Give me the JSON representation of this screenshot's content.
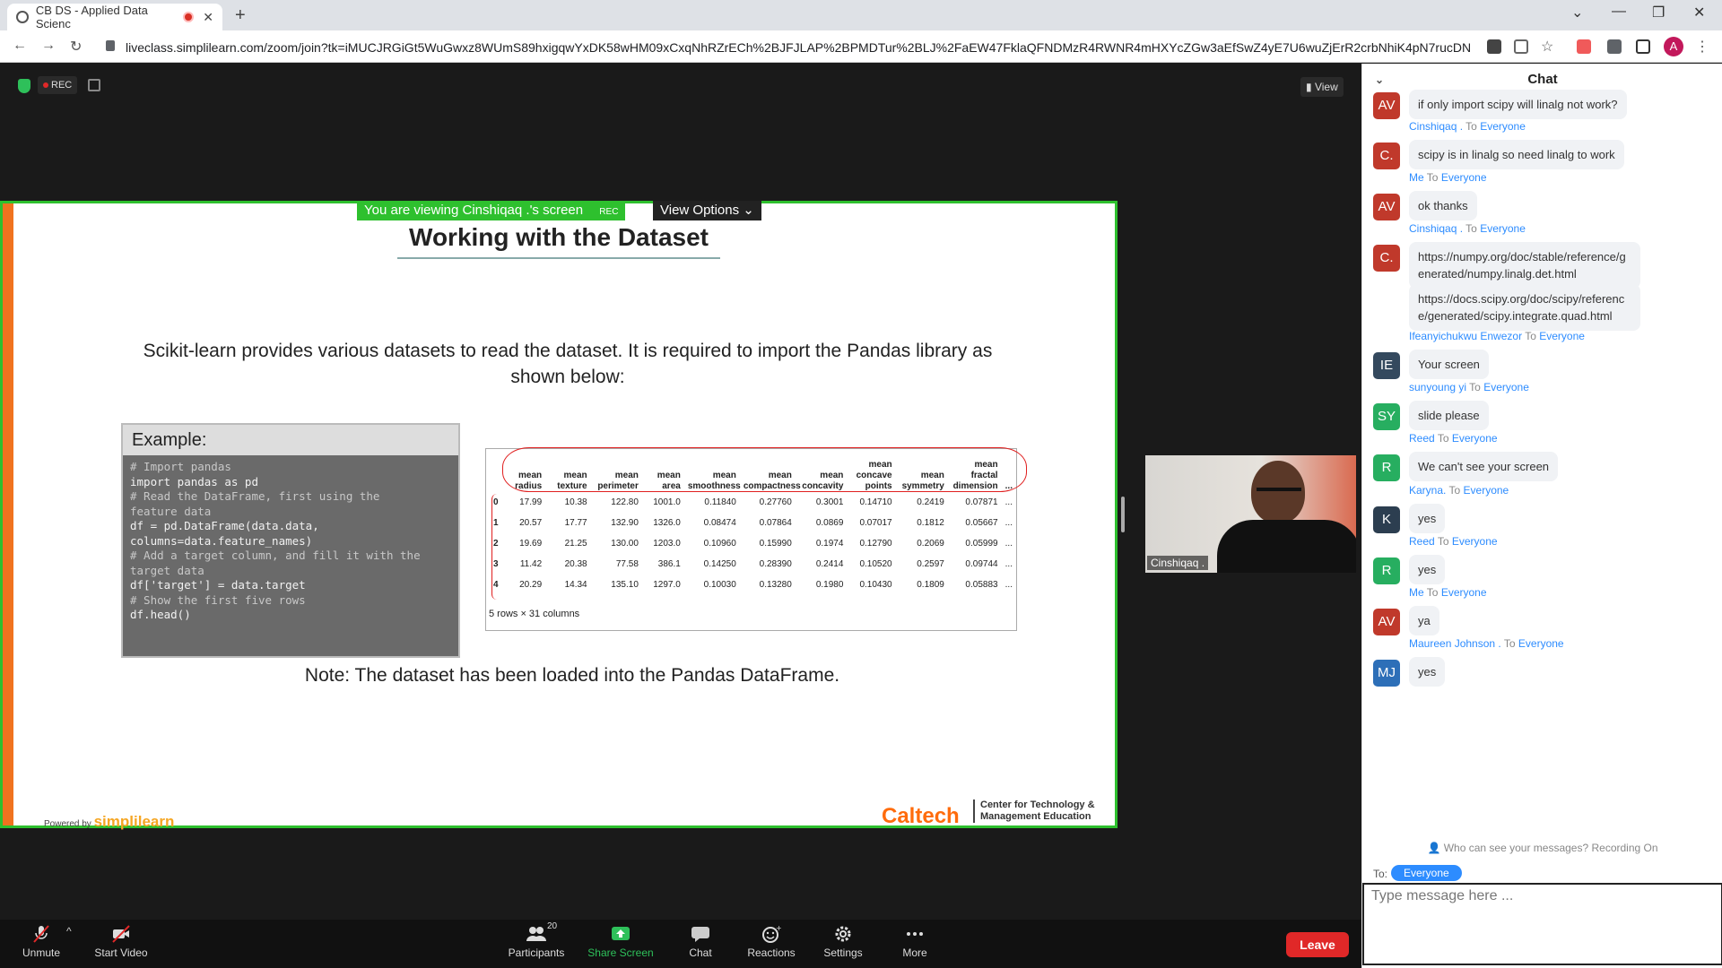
{
  "browser": {
    "tab_title": "CB DS - Applied Data Scienc",
    "url": "liveclass.simplilearn.com/zoom/join?tk=iMUCJRGiGt5WuGwxz8WUmS89hxigqwYxDK58wHM09xCxqNhRZrECh%2BJFJLAP%2BPMDTur%2BLJ%2FaEW47FklaQFNDMzR4RWNR4mHXYcZGw3aEfSwZ4yE7U6wuZjErR2crbNhiK4pN7rucDNn5pcxSOy6...",
    "profile_initial": "A"
  },
  "zoom": {
    "rec_label": "REC",
    "view_label": "View",
    "viewing_banner": "You are viewing Cinshiqaq .'s screen",
    "banner_rec": "REC",
    "view_options": "View Options",
    "presenter_name": "Cinshiqaq ."
  },
  "slide": {
    "title": "Working with the Dataset",
    "body": "Scikit-learn provides various datasets to read the dataset. It is required to import the Pandas library as shown below:",
    "example_label": "Example:",
    "code_lines": [
      {
        "text": "# Import pandas",
        "comment": true
      },
      {
        "text": "import pandas as pd",
        "comment": false
      },
      {
        "text": "# Read the DataFrame, first using the",
        "comment": true
      },
      {
        "text": "feature data",
        "comment": true
      },
      {
        "text": "df = pd.DataFrame(data.data,",
        "comment": false
      },
      {
        "text": "columns=data.feature_names)",
        "comment": false
      },
      {
        "text": "# Add a target column, and fill it with the",
        "comment": true
      },
      {
        "text": "target data",
        "comment": true
      },
      {
        "text": "df['target'] = data.target",
        "comment": false
      },
      {
        "text": "# Show the first five rows",
        "comment": true
      },
      {
        "text": "df.head()",
        "comment": false
      }
    ],
    "table": {
      "headers": [
        "",
        "mean radius",
        "mean texture",
        "mean perimeter",
        "mean area",
        "mean smoothness",
        "mean compactness",
        "mean concavity",
        "mean concave points",
        "mean symmetry",
        "mean fractal dimension",
        "..."
      ],
      "rows": [
        [
          "0",
          "17.99",
          "10.38",
          "122.80",
          "1001.0",
          "0.11840",
          "0.27760",
          "0.3001",
          "0.14710",
          "0.2419",
          "0.07871",
          "..."
        ],
        [
          "1",
          "20.57",
          "17.77",
          "132.90",
          "1326.0",
          "0.08474",
          "0.07864",
          "0.0869",
          "0.07017",
          "0.1812",
          "0.05667",
          "..."
        ],
        [
          "2",
          "19.69",
          "21.25",
          "130.00",
          "1203.0",
          "0.10960",
          "0.15990",
          "0.1974",
          "0.12790",
          "0.2069",
          "0.05999",
          "..."
        ],
        [
          "3",
          "11.42",
          "20.38",
          "77.58",
          "386.1",
          "0.14250",
          "0.28390",
          "0.2414",
          "0.10520",
          "0.2597",
          "0.09744",
          "..."
        ],
        [
          "4",
          "20.29",
          "14.34",
          "135.10",
          "1297.0",
          "0.10030",
          "0.13280",
          "0.1980",
          "0.10430",
          "0.1809",
          "0.05883",
          "..."
        ]
      ],
      "shape_note": "5 rows × 31 columns"
    },
    "note": "Note: The dataset has been loaded into the Pandas DataFrame.",
    "powered_by": "Powered by",
    "powered_brand": "simplilearn",
    "caltech": "Caltech",
    "caltech_sub_1": "Center for Technology &",
    "caltech_sub_2": "Management Education"
  },
  "toolbar": {
    "unmute": "Unmute",
    "start_video": "Start Video",
    "participants": "Participants",
    "participants_count": "20",
    "share_screen": "Share Screen",
    "chat": "Chat",
    "reactions": "Reactions",
    "settings": "Settings",
    "more": "More",
    "leave": "Leave"
  },
  "chat": {
    "title": "Chat",
    "to_word": "To",
    "messages": [
      {
        "initials": "AV",
        "color": "#c0392b",
        "sender": "",
        "recipient": "",
        "text": "if only import scipy will linalg not work?"
      },
      {
        "initials": "C.",
        "color": "#c0392b",
        "sender": "Cinshiqaq .",
        "recipient": "Everyone",
        "text": "scipy is in linalg so need linalg to work"
      },
      {
        "initials": "AV",
        "color": "#c0392b",
        "sender": "Me",
        "recipient": "Everyone",
        "text": "ok thanks"
      },
      {
        "initials": "C.",
        "color": "#c0392b",
        "sender": "Cinshiqaq .",
        "recipient": "Everyone",
        "text": "https://numpy.org/doc/stable/reference/generated/numpy.linalg.det.html"
      },
      {
        "initials": "",
        "color": "",
        "sender": "",
        "recipient": "",
        "text": "https://docs.scipy.org/doc/scipy/reference/generated/scipy.integrate.quad.html"
      },
      {
        "initials": "IE",
        "color": "#34495e",
        "sender": "Ifeanyichukwu Enwezor",
        "recipient": "Everyone",
        "text": "Your screen"
      },
      {
        "initials": "SY",
        "color": "#27ae60",
        "sender": "sunyoung yi",
        "recipient": "Everyone",
        "text": "slide please"
      },
      {
        "initials": "R",
        "color": "#27ae60",
        "sender": "Reed",
        "recipient": "Everyone",
        "text": "We can't see your screen"
      },
      {
        "initials": "K",
        "color": "#2c3e50",
        "sender": "Karyna.",
        "recipient": "Everyone",
        "text": "yes"
      },
      {
        "initials": "R",
        "color": "#27ae60",
        "sender": "Reed",
        "recipient": "Everyone",
        "text": "yes"
      },
      {
        "initials": "AV",
        "color": "#c0392b",
        "sender": "Me",
        "recipient": "Everyone",
        "text": "ya"
      },
      {
        "initials": "MJ",
        "color": "#2d6fb8",
        "sender": "Maureen Johnson .",
        "recipient": "Everyone",
        "text": "yes"
      }
    ],
    "who_can_see": "Who can see your messages? Recording On",
    "to_label": "To:",
    "to_value": "Everyone",
    "input_placeholder": "Type message here ..."
  }
}
